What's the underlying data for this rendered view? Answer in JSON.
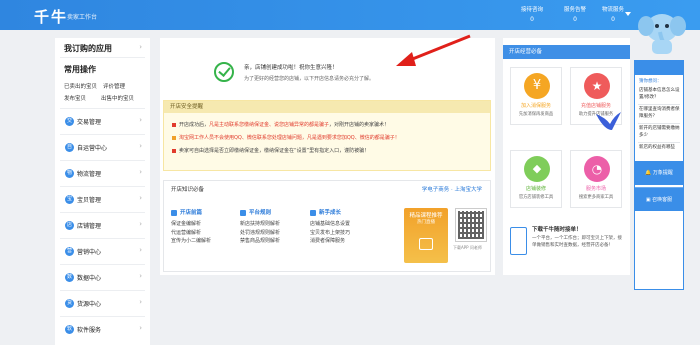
{
  "header": {
    "logo": "千牛",
    "logo_sub": "卖家工作台",
    "stats": [
      {
        "label": "接待咨询",
        "value": "0"
      },
      {
        "label": "服务告警",
        "value": "0"
      },
      {
        "label": "物流服务",
        "value": "0"
      }
    ]
  },
  "sidebar": {
    "my_apps": "我订购的应用",
    "common_ops": "常用操作",
    "quick_links": [
      "已卖出的宝贝",
      "评价管理",
      "发布宝贝",
      "出售中的宝贝"
    ],
    "items": [
      {
        "icon": "交",
        "label": "交易管理"
      },
      {
        "icon": "自",
        "label": "自运营中心"
      },
      {
        "icon": "物",
        "label": "物流管理"
      },
      {
        "icon": "宝",
        "label": "宝贝管理"
      },
      {
        "icon": "店",
        "label": "店铺管理"
      },
      {
        "icon": "营",
        "label": "营销中心"
      },
      {
        "icon": "数",
        "label": "数据中心"
      },
      {
        "icon": "货",
        "label": "货源中心"
      },
      {
        "icon": "软",
        "label": "软件服务"
      }
    ]
  },
  "success": {
    "line1": "亲，店铺创建成功啦！祝你生意兴隆！",
    "line2": "为了更好的经营您的店铺，以下开店信息请务必充分了解。"
  },
  "notice": {
    "title": "开店安全提醒",
    "items": [
      {
        "pre": "开店成功后，",
        "red": "凡是主动联系您缴纳保证金、说您店铺异常的都是骗子",
        "post": "，对刚开店铺的卖家骗术！"
      },
      {
        "pre": "",
        "red": "淘宝网工作人员不会使用QQ、微信联系您处理店铺问题，凡是遇到要求您加QQ、微信的都是骗子！",
        "post": ""
      },
      {
        "pre": "卖家可自由选择是否立即缴纳保证金，缴纳保证金在“设置”里有指定入口，谨防被骗！",
        "red": "",
        "post": ""
      }
    ]
  },
  "knowledge": {
    "title": "开店知识必备",
    "links": "学电子商务 · 上淘宝大学",
    "columns": [
      {
        "head": "开店前篇",
        "lines": [
          "保证金编解析",
          "代运营编解析",
          "宣传为小二编解析"
        ]
      },
      {
        "head": "平台规则",
        "lines": [
          "新店扶持规则解析",
          "处罚违规规则解析",
          "禁售商品规则解析"
        ]
      },
      {
        "head": "新手成长",
        "lines": [
          "店铺基础信息设置",
          "宝贝发布上架技巧",
          "消费者保障服务"
        ]
      }
    ],
    "course_title": "精品课程推荐",
    "course_sub": "热门直播",
    "qr_caption": "下载APP 问老师"
  },
  "right": {
    "title": "开店经营必备",
    "cards": [
      {
        "title": "加入消保服务",
        "desc": "先加消保再发商品",
        "color": "#f5a623",
        "icon": "¥"
      },
      {
        "title": "充值店铺服务",
        "desc": "助力提升店铺服务",
        "color": "#ef5b5b",
        "icon": "★"
      },
      {
        "title": "店铺装修",
        "desc": "官方店铺装修工具",
        "color": "#7fcd5a",
        "icon": "◆"
      },
      {
        "title": "服务市场",
        "desc": "搜索更多商家工具",
        "color": "#ec5fa8",
        "icon": "◔"
      }
    ],
    "app_title": "下载千牛随时接单！",
    "app_desc": "一个平台，一个工作台；即可宝贝上下架，接单做销售和实时查数据，经营开店必备！"
  },
  "float_panel": {
    "title": "猜你想问：",
    "questions": [
      "店铺基本信息怎么设置/修改？",
      "在哪里查询消费者保障服务？",
      "新开的店铺需要缴纳多少",
      "新店的权益有哪些"
    ],
    "btn1": "万象提醒",
    "btn2": "召唤客服"
  },
  "colors": {
    "brand": "#3a8ee8",
    "warn_red": "#e13b2c",
    "success": "#35b34a"
  }
}
